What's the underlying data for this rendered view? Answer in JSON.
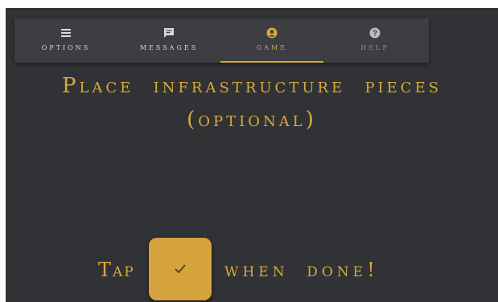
{
  "nav": {
    "tabs": [
      {
        "label": "Options",
        "icon": "menu-icon"
      },
      {
        "label": "Messages",
        "icon": "message-icon"
      },
      {
        "label": "Game",
        "icon": "user-icon",
        "active": true
      },
      {
        "label": "Help",
        "icon": "help-icon"
      }
    ]
  },
  "main": {
    "title_line1": "Place infrastructure pieces",
    "title_line2": "(optional)",
    "tap_word": "Tap",
    "done_text": "when done!",
    "done_button_icon": "check-icon"
  },
  "colors": {
    "background": "#313235",
    "nav_background": "#3d3e42",
    "accent": "#d8a93a",
    "button": "#d6a33c"
  }
}
